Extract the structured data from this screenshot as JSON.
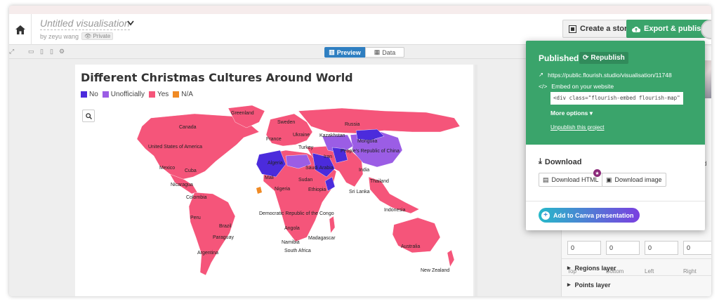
{
  "header": {
    "title": "Untitled visualisation",
    "byline": "by zeyu wang",
    "privacy": "Private",
    "story_button": "Create a story",
    "export_button": "Export & publish"
  },
  "toolbar": {
    "preview_tab": "Preview",
    "data_tab": "Data"
  },
  "chart": {
    "title": "Different Christmas Cultures Around World",
    "legend": [
      {
        "label": "No",
        "color": "#4b2bdc"
      },
      {
        "label": "Unofficially",
        "color": "#9b5de5"
      },
      {
        "label": "Yes",
        "color": "#f5557a"
      },
      {
        "label": "N/A",
        "color": "#f08a24"
      }
    ],
    "countries": [
      "Greenland",
      "Canada",
      "United States of America",
      "Mexico",
      "Cuba",
      "Nicaragua",
      "Colombia",
      "Peru",
      "Brazil",
      "Paraguay",
      "Argentina",
      "Sweden",
      "Russia",
      "Ukraine",
      "France",
      "Kazakhstan",
      "Mongolia",
      "Turkey",
      "People's Republic of China",
      "Iran",
      "Algeria",
      "Saudi Arabia",
      "India",
      "Mali",
      "Sudan",
      "Nigeria",
      "Ethiopia",
      "Thailand",
      "Sri Lanka",
      "Democratic Republic of the Congo",
      "Indonesia",
      "Angola",
      "Madagascar",
      "Namibia",
      "South Africa",
      "Australia",
      "New Zealand"
    ]
  },
  "settings": {
    "regions_layer": "Regions layer",
    "points_layer": "Points layer",
    "partial_label": "ced",
    "margins": [
      {
        "label": "Top",
        "value": "0"
      },
      {
        "label": "Bottom",
        "value": "0"
      },
      {
        "label": "Left",
        "value": "0"
      },
      {
        "label": "Right",
        "value": "0"
      }
    ]
  },
  "popup": {
    "published_label": "Published",
    "republish_label": "Republish",
    "url": "https://public.flourish.studio/visualisation/11748",
    "embed_label": "Embed on your website",
    "embed_code": "<div class=\"flourish-embed flourish-map\" data-",
    "more_options": "More options",
    "unpublish": "Unpublish this project",
    "download_title": "Download",
    "download_html": "Download HTML",
    "download_image": "Download image",
    "canva_button": "Add to Canva presentation"
  }
}
